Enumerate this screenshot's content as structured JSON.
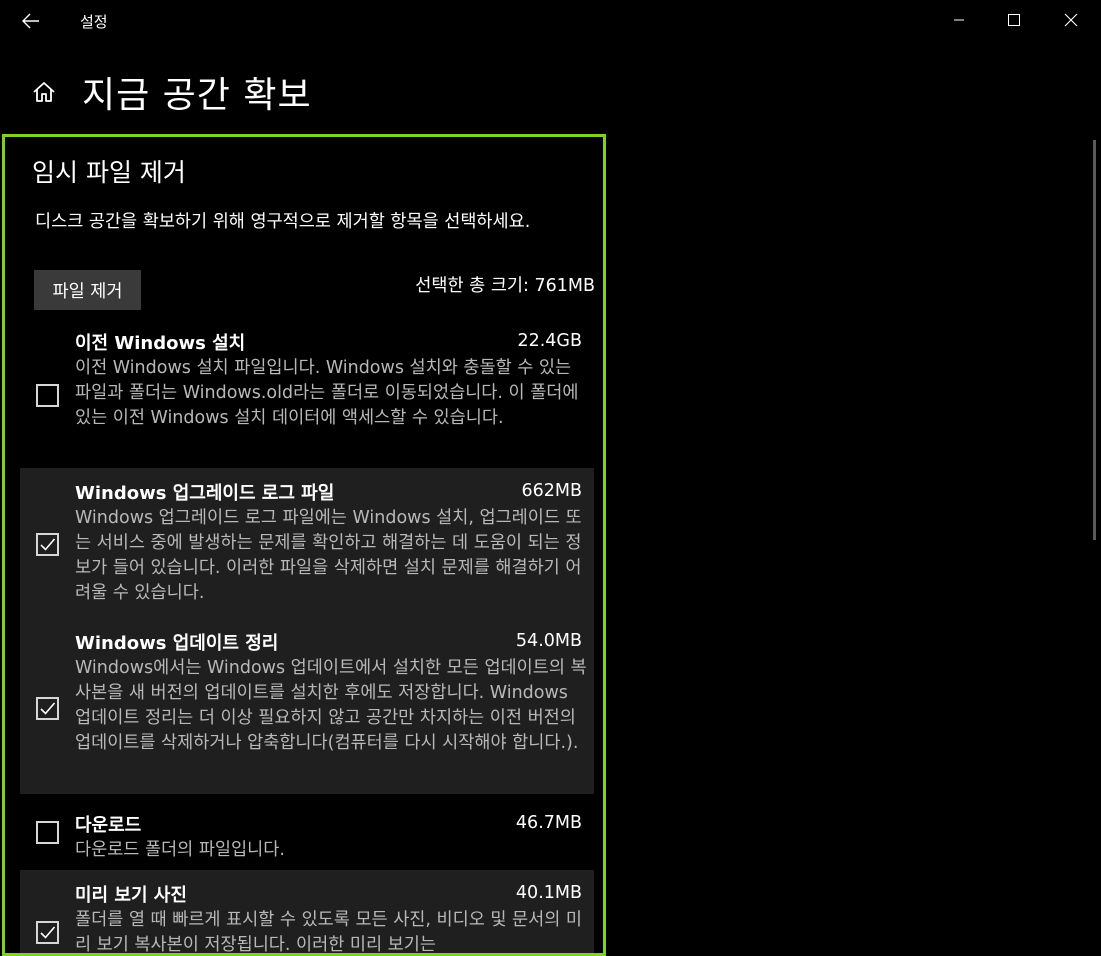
{
  "window": {
    "app_title": "설정"
  },
  "page": {
    "title": "지금 공간 확보"
  },
  "section": {
    "title": "임시 파일 제거",
    "description": "디스크 공간을 확보하기 위해 영구적으로 제거할 항목을 선택하세요.",
    "remove_button_label": "파일 제거",
    "total_size_label": "선택한 총 크기: 761MB"
  },
  "items": [
    {
      "name": "이전 Windows 설치",
      "size": "22.4GB",
      "checked": false,
      "description": "이전 Windows 설치 파일입니다. Windows 설치와 충돌할 수 있는 파일과 폴더는 Windows.old라는 폴더로 이동되었습니다. 이 폴더에 있는 이전 Windows 설치 데이터에 액세스할 수 있습니다."
    },
    {
      "name": "Windows 업그레이드 로그 파일",
      "size": "662MB",
      "checked": true,
      "description": "Windows 업그레이드 로그 파일에는 Windows 설치, 업그레이드 또는 서비스 중에 발생하는 문제를 확인하고 해결하는 데 도움이 되는 정보가 들어 있습니다. 이러한 파일을 삭제하면 설치 문제를 해결하기 어려울 수 있습니다."
    },
    {
      "name": "Windows 업데이트 정리",
      "size": "54.0MB",
      "checked": true,
      "description": "Windows에서는 Windows 업데이트에서 설치한 모든 업데이트의 복사본을 새 버전의 업데이트를 설치한 후에도 저장합니다. Windows 업데이트 정리는 더 이상 필요하지 않고 공간만 차지하는 이전 버전의 업데이트를 삭제하거나 압축합니다(컴퓨터를 다시 시작해야 합니다.)."
    },
    {
      "name": "다운로드",
      "size": "46.7MB",
      "checked": false,
      "description": "다운로드 폴더의 파일입니다."
    },
    {
      "name": "미리 보기 사진",
      "size": "40.1MB",
      "checked": true,
      "description": "폴더를 열 때 빠르게 표시할 수 있도록 모든 사진, 비디오 및 문서의 미리 보기 복사본이 저장됩니다. 이러한 미리 보기는"
    }
  ],
  "colors": {
    "background": "#000000",
    "highlight_border": "#7ed321",
    "selected_row": "#1f1f1f",
    "button_bg": "#3a3a3a",
    "secondary_text": "#b8b8b8"
  }
}
